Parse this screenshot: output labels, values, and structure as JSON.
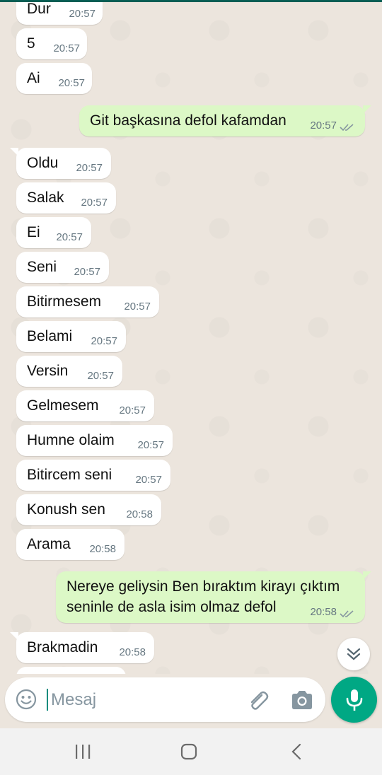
{
  "incoming_top": [
    {
      "text": "Dur",
      "time": "20:57"
    },
    {
      "text": "5",
      "time": "20:57"
    },
    {
      "text": "Ai",
      "time": "20:57"
    }
  ],
  "outgoing_1": {
    "text": "Git başkasına defol kafamdan",
    "time": "20:57",
    "status": "read"
  },
  "incoming_mid": [
    {
      "text": "Oldu",
      "time": "20:57"
    },
    {
      "text": "Salak",
      "time": "20:57"
    },
    {
      "text": "Ei",
      "time": "20:57"
    },
    {
      "text": "Seni",
      "time": "20:57"
    },
    {
      "text": "Bitirmesem",
      "time": "20:57"
    },
    {
      "text": "Belami",
      "time": "20:57"
    },
    {
      "text": "Versin",
      "time": "20:57"
    },
    {
      "text": "Gelmesem",
      "time": "20:57"
    },
    {
      "text": "Humne olaim",
      "time": "20:57"
    },
    {
      "text": "Bitircem seni",
      "time": "20:57"
    },
    {
      "text": "Konush sen",
      "time": "20:58"
    },
    {
      "text": "Arama",
      "time": "20:58"
    }
  ],
  "outgoing_2": {
    "line1": "Nereye geliysin Ben bıraktım kirayı çıktım",
    "line2": "seninle de asla isim olmaz defol",
    "time": "20:58",
    "status": "read"
  },
  "incoming_bottom": [
    {
      "text": "Brakmadin",
      "time": "20:58"
    }
  ],
  "composer": {
    "placeholder": "Mesaj"
  },
  "icons": {
    "emoji": "emoji-icon",
    "attach": "paperclip-icon",
    "camera": "camera-icon",
    "mic": "mic-icon",
    "scroll": "double-chevron-down-icon"
  },
  "colors": {
    "chat_bg": "#ece5dd",
    "incoming_bubble": "#ffffff",
    "outgoing_bubble": "#dcf8c6",
    "accent": "#00a884",
    "read_ticks": "#8696a0"
  }
}
